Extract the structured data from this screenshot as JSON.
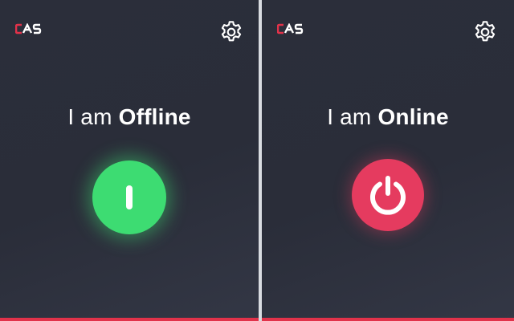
{
  "panels": [
    {
      "status_prefix": "I am",
      "status_state": "Offline",
      "power_icon": "power-bar-icon",
      "power_color": "#3ddc72"
    },
    {
      "status_prefix": "I am",
      "status_state": "Online",
      "power_icon": "power-symbol-icon",
      "power_color": "#e53b5f"
    }
  ],
  "colors": {
    "panel_bg": "#2b2e3a",
    "accent_red": "#e1324a",
    "logo_red": "#e1324a"
  }
}
